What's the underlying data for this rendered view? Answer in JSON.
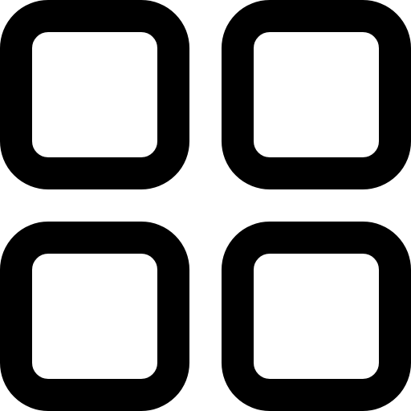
{
  "icon": {
    "name": "grid-view-icon",
    "color": "#000000",
    "background": "#ffffff",
    "tiles": 4
  }
}
